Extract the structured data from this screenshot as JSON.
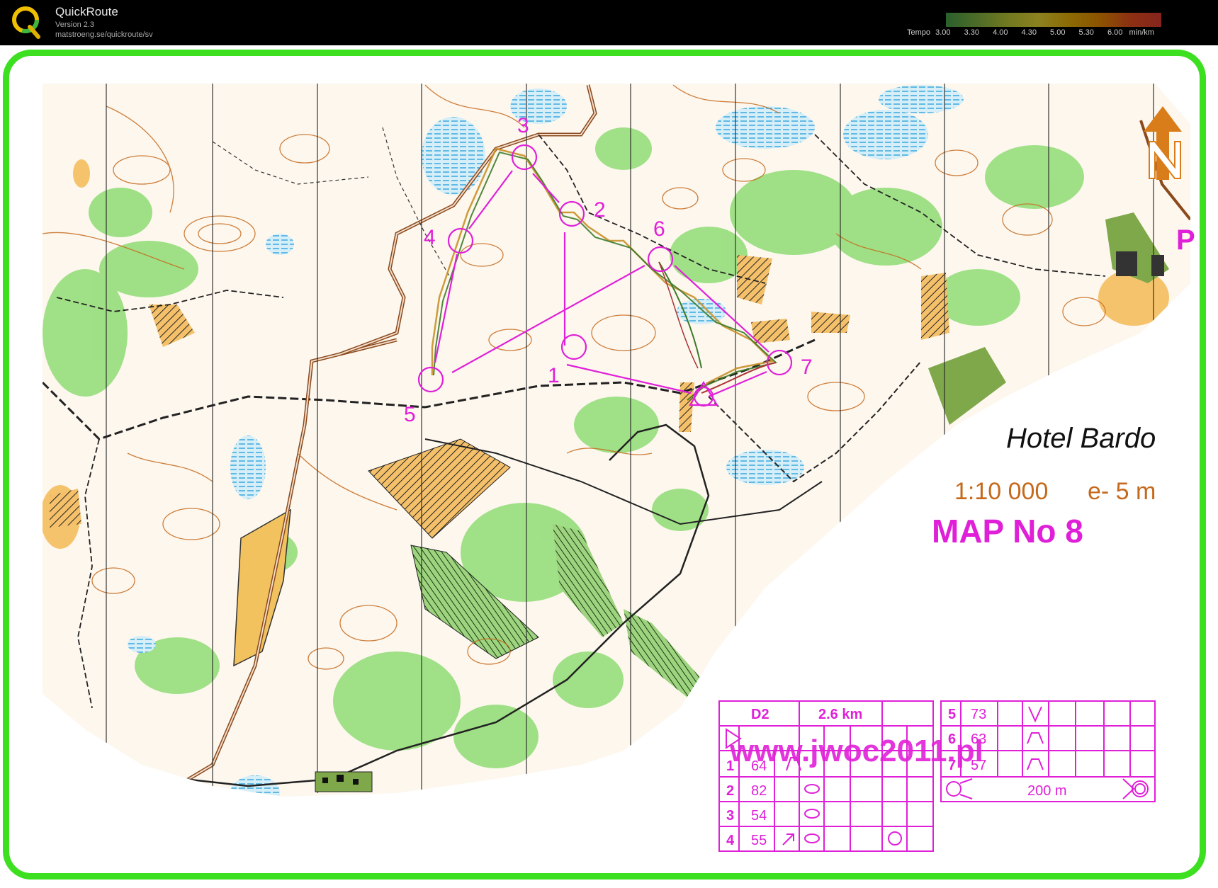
{
  "app": {
    "title": "QuickRoute",
    "version": "Version 2.3",
    "url": "matstroeng.se/quickroute/sv"
  },
  "pace_legend": {
    "label": "Tempo",
    "ticks": [
      "3.00",
      "3.30",
      "4.00",
      "4.30",
      "5.00",
      "5.30",
      "6.00"
    ],
    "unit": "min/km"
  },
  "map": {
    "name": "Hotel Bardo",
    "scale": "1:10 000",
    "contour_interval": "e- 5 m",
    "map_number": "MAP No 8",
    "parking_symbol": "P",
    "watermark": "www.jwoc2011.pl",
    "control_numbers": [
      "1",
      "2",
      "3",
      "4",
      "5",
      "6",
      "7"
    ]
  },
  "control_description": {
    "class": "D2",
    "length": "2.6 km",
    "rows": [
      {
        "seq": "1",
        "code": "64"
      },
      {
        "seq": "2",
        "code": "82"
      },
      {
        "seq": "3",
        "code": "54"
      },
      {
        "seq": "4",
        "code": "55"
      },
      {
        "seq": "5",
        "code": "73"
      },
      {
        "seq": "6",
        "code": "63"
      },
      {
        "seq": "7",
        "code": "57"
      }
    ],
    "finish_distance": "200 m"
  },
  "colors": {
    "frame": "#3de021",
    "course": "#e020d8",
    "terrain_brown": "#c56a1c",
    "vegetation_green": "#7fd86a",
    "water_blue": "#4ab8e0"
  }
}
